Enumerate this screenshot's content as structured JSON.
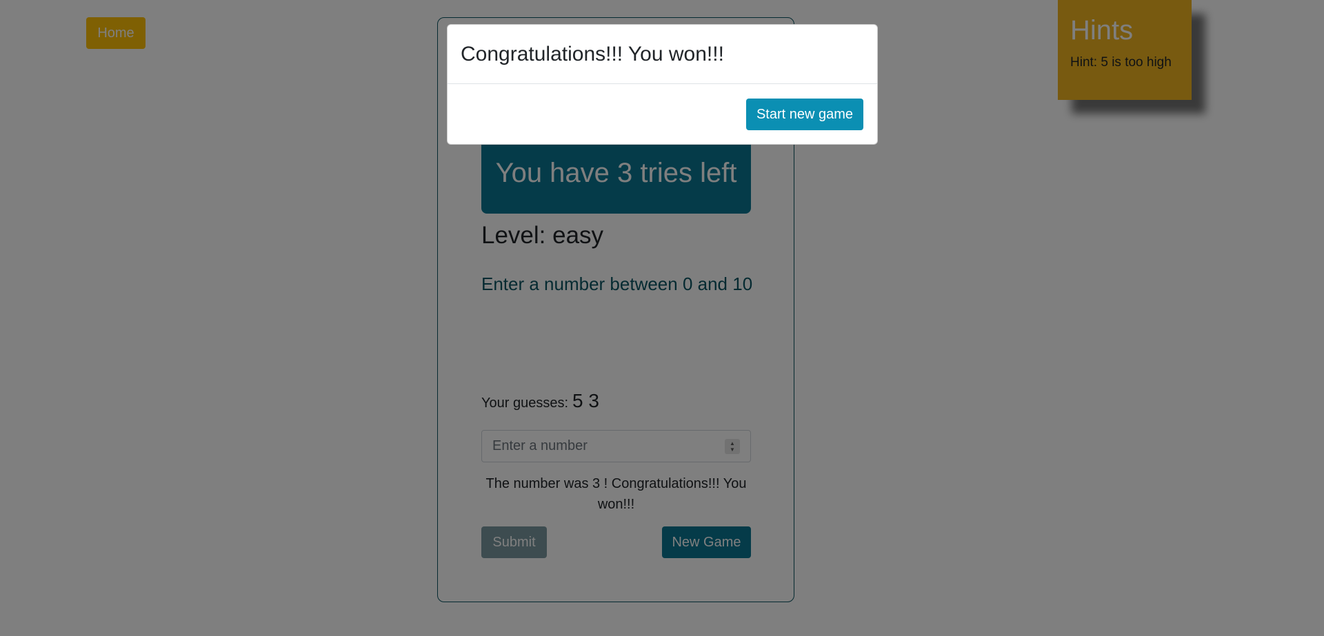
{
  "nav": {
    "home_label": "Home"
  },
  "hints": {
    "title": "Hints",
    "items": [
      "Hint: 5 is too high"
    ]
  },
  "game": {
    "tries_text": "You have 3 tries left",
    "level_text": "Level: easy",
    "instruction": "Enter a number between 0 and 10",
    "guesses_label": "Your guesses:",
    "guesses_values": "5 3",
    "input_placeholder": "Enter a number",
    "result_text": "The number was 3 ! Congratulations!!! You won!!!",
    "submit_label": "Submit",
    "new_game_label": "New Game"
  },
  "modal": {
    "title": "Congratulations!!! You won!!!",
    "start_label": "Start new game"
  },
  "colors": {
    "accent": "#0b7793",
    "warning": "#ffc107",
    "backdrop": "rgba(0,0,0,0.5)"
  }
}
